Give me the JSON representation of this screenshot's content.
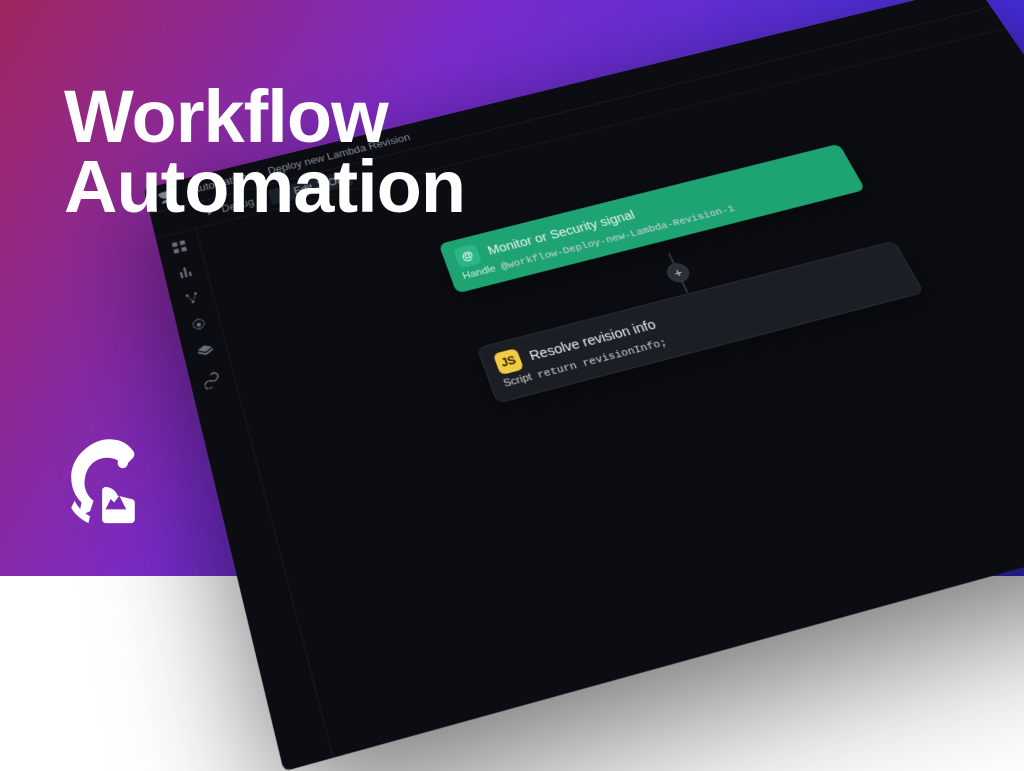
{
  "overlay": {
    "line1": "Workflow",
    "line2": "Automation"
  },
  "breadcrumb": {
    "root": "Automation",
    "page": "Deploy new Lambda Revision"
  },
  "toolbar": {
    "debug": "Debug",
    "edit_json": "Edit JSON"
  },
  "nodes": {
    "trigger": {
      "title": "Monitor or Security signal",
      "handle_label": "Handle",
      "handle_value": "@workflow-Deploy-new-Lambda-Revision-1"
    },
    "script": {
      "title": "Resolve revision info",
      "script_label": "Script",
      "script_value": "return revisionInfo;"
    }
  },
  "icons": {
    "plus": "+"
  }
}
